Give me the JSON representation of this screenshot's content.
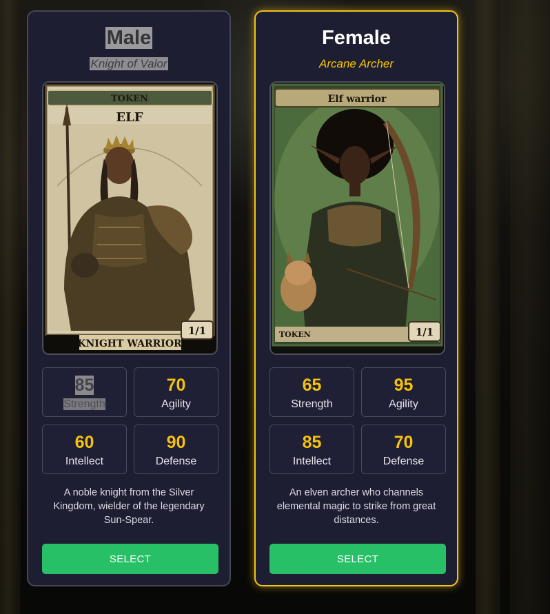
{
  "characters": {
    "male": {
      "name": "Male",
      "subtitle": "Knight of Valor",
      "card": {
        "top_label": "TOKEN",
        "race": "ELF",
        "type_line": "KNIGHT WARRIOR",
        "power_toughness": "1/1"
      },
      "stats": [
        {
          "value": "85",
          "label": "Strength"
        },
        {
          "value": "70",
          "label": "Agility"
        },
        {
          "value": "60",
          "label": "Intellect"
        },
        {
          "value": "90",
          "label": "Defense"
        }
      ],
      "description": "A noble knight from the Silver Kingdom, wielder of the legendary Sun-Spear.",
      "select_label": "SELECT"
    },
    "female": {
      "name": "Female",
      "subtitle": "Arcane Archer",
      "card": {
        "top_label": "Elf warrior",
        "bottom_label": "TOKEN",
        "power_toughness": "1/1"
      },
      "stats": [
        {
          "value": "65",
          "label": "Strength"
        },
        {
          "value": "95",
          "label": "Agility"
        },
        {
          "value": "85",
          "label": "Intellect"
        },
        {
          "value": "70",
          "label": "Defense"
        }
      ],
      "description": "An elven archer who channels elemental magic to strike from great distances.",
      "select_label": "SELECT"
    }
  },
  "colors": {
    "accent": "#f7c20d",
    "selected_border": "#f2c31b",
    "button": "#28c066",
    "card_bg": "#1e1e33"
  },
  "selected": "female"
}
